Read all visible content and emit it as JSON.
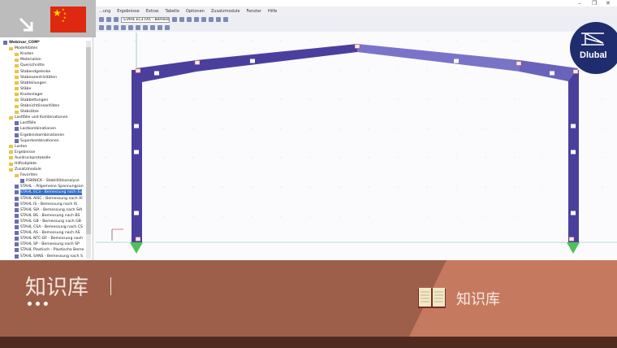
{
  "window": {
    "minimize": "–",
    "restore": "❐",
    "close": "✕"
  },
  "menu": [
    "...ung",
    "Ergebnisse",
    "Extras",
    "Tabelle",
    "Optionen",
    "Zusatzmodule",
    "Fenster",
    "Hilfe"
  ],
  "toolbar": {
    "combo_value": "STAHL EC3 FA1 - Bemessun"
  },
  "tree": [
    {
      "label": "Webinar_COM*",
      "level": 0,
      "type": "root"
    },
    {
      "label": "Modelldaten",
      "level": 1,
      "type": "folder"
    },
    {
      "label": "Knoten",
      "level": 2,
      "type": "folder"
    },
    {
      "label": "Materialien",
      "level": 2,
      "type": "folder"
    },
    {
      "label": "Querschnitte",
      "level": 2,
      "type": "folder"
    },
    {
      "label": "Stabendgelenke",
      "level": 2,
      "type": "folder"
    },
    {
      "label": "Stabexzentrizitäten",
      "level": 2,
      "type": "folder"
    },
    {
      "label": "Stabteilungen",
      "level": 2,
      "type": "folder"
    },
    {
      "label": "Stäbe",
      "level": 2,
      "type": "folder"
    },
    {
      "label": "Knotenlager",
      "level": 2,
      "type": "folder"
    },
    {
      "label": "Stabbettungen",
      "level": 2,
      "type": "folder"
    },
    {
      "label": "Stabnichtlinearitäten",
      "level": 2,
      "type": "folder"
    },
    {
      "label": "Stabsätze",
      "level": 2,
      "type": "folder"
    },
    {
      "label": "Lastfälle und Kombinationen",
      "level": 1,
      "type": "folder"
    },
    {
      "label": "Lastfälle",
      "level": 2,
      "type": "item"
    },
    {
      "label": "Lastkombinationen",
      "level": 2,
      "type": "item"
    },
    {
      "label": "Ergebniskombinationen",
      "level": 2,
      "type": "item"
    },
    {
      "label": "Superkombinationen",
      "level": 2,
      "type": "item"
    },
    {
      "label": "Lasten",
      "level": 1,
      "type": "folder"
    },
    {
      "label": "Ergebnisse",
      "level": 1,
      "type": "folder"
    },
    {
      "label": "Ausdruckprotokolle",
      "level": 1,
      "type": "folder"
    },
    {
      "label": "Hilfsobjekte",
      "level": 1,
      "type": "folder"
    },
    {
      "label": "Zusatzmodule",
      "level": 1,
      "type": "folder"
    },
    {
      "label": "Favoriten",
      "level": 2,
      "type": "folder"
    },
    {
      "label": "RSKNICK - Stabilitätsanalyse",
      "level": 3,
      "type": "module"
    },
    {
      "label": "STAHL - Allgemeine Spannungsan",
      "level": 2,
      "type": "module"
    },
    {
      "label": "STAHL EC3 - Bemessung nach Eu",
      "level": 2,
      "type": "module",
      "selected": true
    },
    {
      "label": "STAHL AISC - Bemessung nach AI",
      "level": 2,
      "type": "module"
    },
    {
      "label": "STAHL IS - Bemessung nach IS",
      "level": 2,
      "type": "module"
    },
    {
      "label": "STAHL SIA - Bemessung nach SIA",
      "level": 2,
      "type": "module"
    },
    {
      "label": "STAHL BS - Bemessung nach BS",
      "level": 2,
      "type": "module"
    },
    {
      "label": "STAHL GB - Bemessung nach GB",
      "level": 2,
      "type": "module"
    },
    {
      "label": "STAHL CSA - Bemessung nach CS",
      "level": 2,
      "type": "module"
    },
    {
      "label": "STAHL AS - Bemessung nach AS",
      "level": 2,
      "type": "module"
    },
    {
      "label": "STAHL NTC-DF - Bemessung nach",
      "level": 2,
      "type": "module"
    },
    {
      "label": "STAHL SP - Bemessung nach SP",
      "level": 2,
      "type": "module"
    },
    {
      "label": "STAHL Plastisch - Plastische Beme",
      "level": 2,
      "type": "module"
    },
    {
      "label": "STAHL SANS - Bemessung nach S",
      "level": 2,
      "type": "module"
    }
  ],
  "logo": {
    "text": "Dlubal",
    "color": "#1f2d6e"
  },
  "banner": {
    "title": "知识库",
    "dots": "•••",
    "label": "知识库",
    "left_color": "#9e5f4a",
    "right_color": "#c57a5f"
  },
  "colors": {
    "member": "#4b3f9e",
    "member_light": "#7a74c8"
  }
}
